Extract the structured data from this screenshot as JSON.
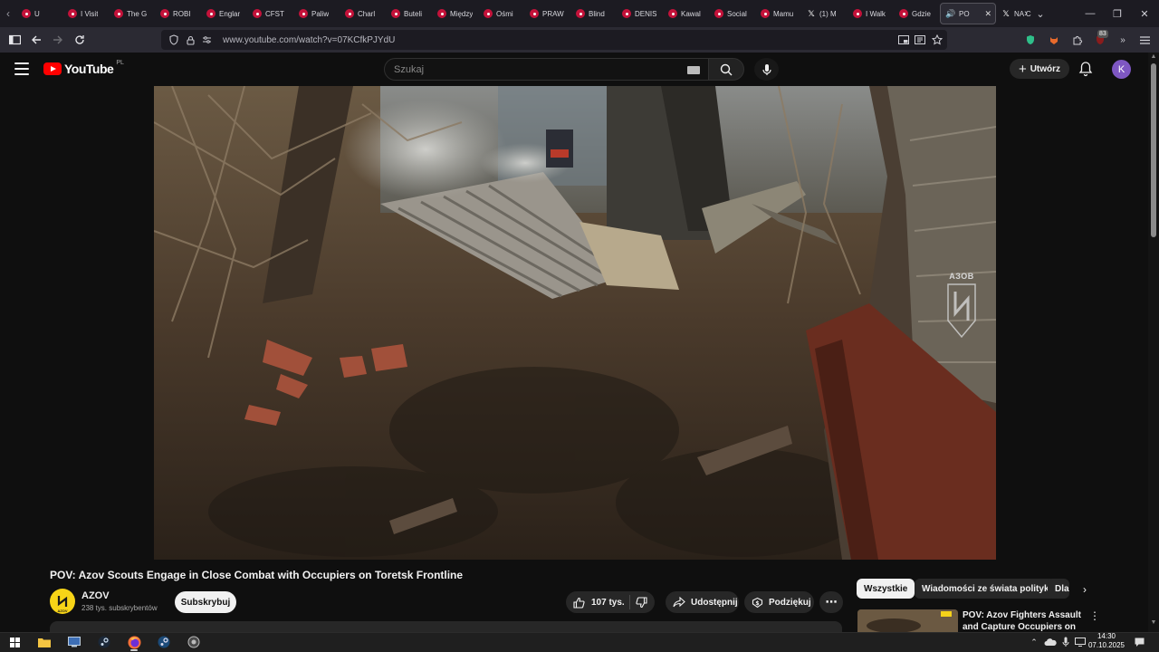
{
  "browser": {
    "tabs": [
      {
        "label": "U",
        "icon": "youtube-favicon"
      },
      {
        "label": "I Visit",
        "icon": "youtube-favicon"
      },
      {
        "label": "The G",
        "icon": "youtube-favicon"
      },
      {
        "label": "ROBI",
        "icon": "youtube-favicon"
      },
      {
        "label": "Englar",
        "icon": "youtube-favicon"
      },
      {
        "label": "CFST",
        "icon": "youtube-favicon"
      },
      {
        "label": "Paliw",
        "icon": "youtube-favicon"
      },
      {
        "label": "Charl",
        "icon": "youtube-favicon"
      },
      {
        "label": "Buteli",
        "icon": "youtube-favicon"
      },
      {
        "label": "Między",
        "icon": "youtube-favicon"
      },
      {
        "label": "Ośmi",
        "icon": "youtube-favicon"
      },
      {
        "label": "PRAW",
        "icon": "youtube-favicon"
      },
      {
        "label": "Blind",
        "icon": "youtube-favicon"
      },
      {
        "label": "DENIS",
        "icon": "youtube-favicon"
      },
      {
        "label": "Kawal",
        "icon": "youtube-favicon"
      },
      {
        "label": "Social",
        "icon": "youtube-favicon"
      },
      {
        "label": "Mamu",
        "icon": "youtube-favicon"
      },
      {
        "label": "(1) M",
        "icon": "x-favicon"
      },
      {
        "label": "I Walk",
        "icon": "youtube-favicon"
      },
      {
        "label": "Gdzie",
        "icon": "youtube-favicon"
      }
    ],
    "active_tab": {
      "label": "PO",
      "icon": "speaker-icon"
    },
    "next_tab": {
      "label": "NA C",
      "icon": "x-favicon"
    },
    "url": "www.youtube.com/watch?v=07KCfkPJYdU",
    "extension_badge": "83"
  },
  "youtube": {
    "logo_text": "YouTube",
    "country_code": "PL",
    "search_placeholder": "Szukaj",
    "create_label": "Utwórz",
    "avatar_letter": "K"
  },
  "video": {
    "title": "POV: Azov Scouts Engage in Close Combat with Occupiers on Toretsk Frontline",
    "watermark": "АЗОВ",
    "channel": {
      "name": "AZOV",
      "subscribers": "238 tys. subskrybentów",
      "avatar_text": "AZOV"
    },
    "subscribe_label": "Subskrybuj",
    "likes": "107 tys.",
    "share_label": "Udostępnij",
    "thanks_label": "Podziękuj"
  },
  "sidebar": {
    "chips": [
      "Wszystkie",
      "Wiadomości ze świata polityki",
      "Dla"
    ],
    "recommendation": {
      "title": "POV: Azov Fighters Assault and Capture Occupiers on Toretsk"
    }
  },
  "taskbar": {
    "time": "14:30",
    "date": "07.10.2025"
  }
}
